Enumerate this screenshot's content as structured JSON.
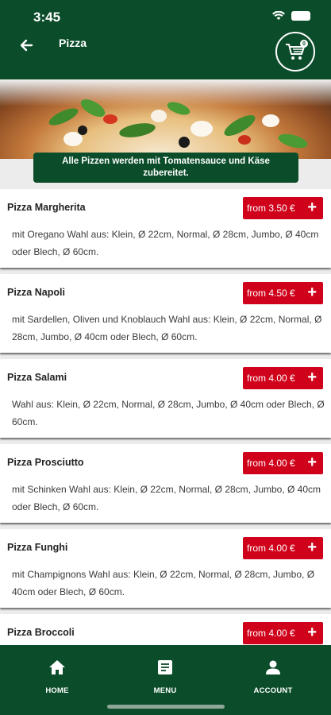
{
  "status_bar": {
    "time": "3:45"
  },
  "header": {
    "title": "Pizza",
    "cart_count": "0"
  },
  "banner": {
    "text": "Alle Pizzen werden mit Tomatensauce und Käse zubereitet."
  },
  "items": [
    {
      "name": "Pizza Margherita",
      "price": "from 3.50 €",
      "description": "mit Oregano  Wahl aus: Klein, Ø 22cm, Normal, Ø 28cm, Jumbo, Ø 40cm oder Blech, Ø 60cm."
    },
    {
      "name": "Pizza Napoli",
      "price": "from 4.50 €",
      "description": "mit Sardellen, Oliven und Knoblauch  Wahl aus: Klein, Ø 22cm, Normal, Ø 28cm, Jumbo, Ø 40cm oder Blech, Ø 60cm."
    },
    {
      "name": "Pizza Salami",
      "price": "from 4.00 €",
      "description": "Wahl aus: Klein, Ø 22cm, Normal, Ø 28cm, Jumbo, Ø 40cm oder Blech, Ø 60cm."
    },
    {
      "name": "Pizza Prosciutto",
      "price": "from 4.00 €",
      "description": "mit Schinken  Wahl aus: Klein, Ø 22cm, Normal, Ø 28cm, Jumbo, Ø 40cm oder Blech, Ø 60cm."
    },
    {
      "name": "Pizza Funghi",
      "price": "from 4.00 €",
      "description": "mit Champignons  Wahl aus: Klein, Ø 22cm, Normal, Ø 28cm, Jumbo, Ø 40cm oder Blech, Ø 60cm."
    },
    {
      "name": "Pizza Broccoli",
      "price": "from 4.00 €",
      "description": ""
    }
  ],
  "bottom_nav": [
    {
      "label": "HOME",
      "icon": "home-icon"
    },
    {
      "label": "MENU",
      "icon": "menu-icon"
    },
    {
      "label": "ACCOUNT",
      "icon": "account-icon"
    }
  ],
  "colors": {
    "brand_green": "#0b4d2a",
    "price_red": "#d0021b"
  }
}
